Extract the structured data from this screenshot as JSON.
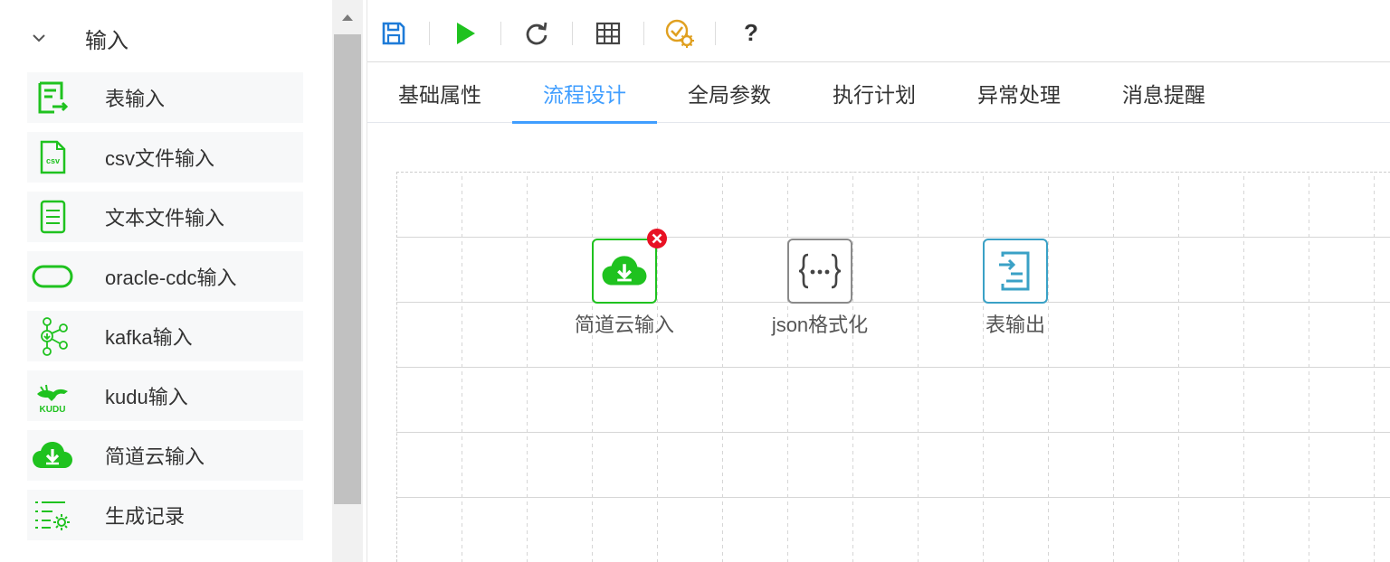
{
  "palette": {
    "group_title": "输入",
    "items": [
      {
        "label": "表输入",
        "icon": "table-input-icon"
      },
      {
        "label": "csv文件输入",
        "icon": "csv-file-icon"
      },
      {
        "label": "文本文件输入",
        "icon": "text-file-icon"
      },
      {
        "label": "oracle-cdc输入",
        "icon": "oracle-icon"
      },
      {
        "label": "kafka输入",
        "icon": "kafka-icon"
      },
      {
        "label": "kudu输入",
        "icon": "kudu-icon"
      },
      {
        "label": "简道云输入",
        "icon": "cloud-download-icon"
      },
      {
        "label": "生成记录",
        "icon": "generate-records-icon"
      }
    ],
    "kudu_logo_text": "KUDU",
    "csv_badge_text": "csv"
  },
  "toolbar": {
    "help_label": "?"
  },
  "tabs": [
    {
      "label": "基础属性",
      "active": false
    },
    {
      "label": "流程设计",
      "active": true
    },
    {
      "label": "全局参数",
      "active": false
    },
    {
      "label": "执行计划",
      "active": false
    },
    {
      "label": "异常处理",
      "active": false
    },
    {
      "label": "消息提醒",
      "active": false
    }
  ],
  "canvas": {
    "nodes": [
      {
        "label": "简道云输入",
        "icon": "cloud-download-icon"
      },
      {
        "label": "json格式化",
        "icon": "json-braces-icon"
      },
      {
        "label": "表输出",
        "icon": "table-output-icon"
      }
    ]
  },
  "colors": {
    "green": "#1fc21f",
    "blue": "#409eff",
    "teal": "#3aa1c6",
    "gray_border": "#8a8a8a",
    "error_red": "#e81123"
  }
}
